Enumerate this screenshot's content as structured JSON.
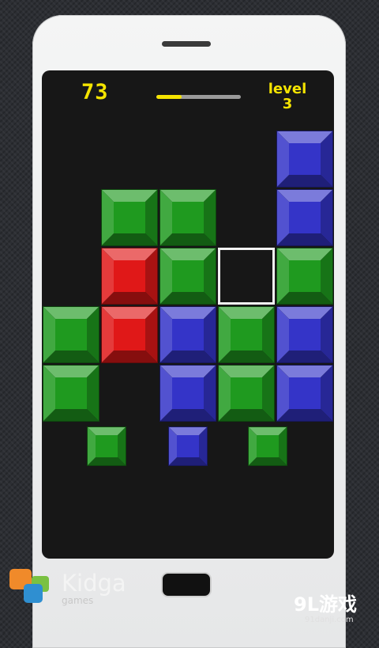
{
  "hud": {
    "score": "73",
    "level_label": "level",
    "level_value": "3",
    "progress_fraction": 0.3
  },
  "colors": {
    "green": "#1f9a1f",
    "blue": "#3434c8",
    "red": "#e01818",
    "accent": "#f5e400"
  },
  "board": {
    "columns": 5,
    "rows": 5,
    "grid": [
      [
        null,
        null,
        null,
        null,
        "blue"
      ],
      [
        null,
        "green",
        "green",
        null,
        "blue"
      ],
      [
        null,
        "red",
        "green",
        null,
        "green"
      ],
      [
        "green",
        "red",
        "blue",
        "green",
        "blue"
      ],
      [
        "green",
        null,
        "blue",
        "green",
        "blue"
      ]
    ],
    "selected_cell": {
      "row": 2,
      "col": 3
    }
  },
  "next_pieces": [
    {
      "slot": 1,
      "color": "green"
    },
    {
      "slot": 2,
      "color": "blue"
    },
    {
      "slot": 3,
      "color": "green"
    }
  ],
  "branding": {
    "logo_text": "Kidga",
    "logo_subtext": "games",
    "watermark_text": "9L游戏",
    "watermark_url": "91danji.com"
  }
}
